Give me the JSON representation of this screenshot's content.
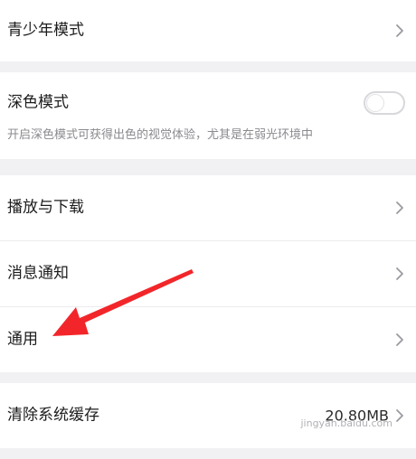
{
  "settings": {
    "teen_mode": {
      "label": "青少年模式"
    },
    "dark_mode": {
      "label": "深色模式",
      "description": "开启深色模式可获得出色的视觉体验，尤其是在弱光环境中",
      "enabled": false
    },
    "play_download": {
      "label": "播放与下载"
    },
    "notifications": {
      "label": "消息通知"
    },
    "general": {
      "label": "通用"
    },
    "clear_cache": {
      "label": "清除系统缓存",
      "value": "20.80MB"
    }
  },
  "annotation": {
    "arrow_color": "#f2262a"
  },
  "watermark": {
    "text": "jingyan.baidu.com"
  }
}
